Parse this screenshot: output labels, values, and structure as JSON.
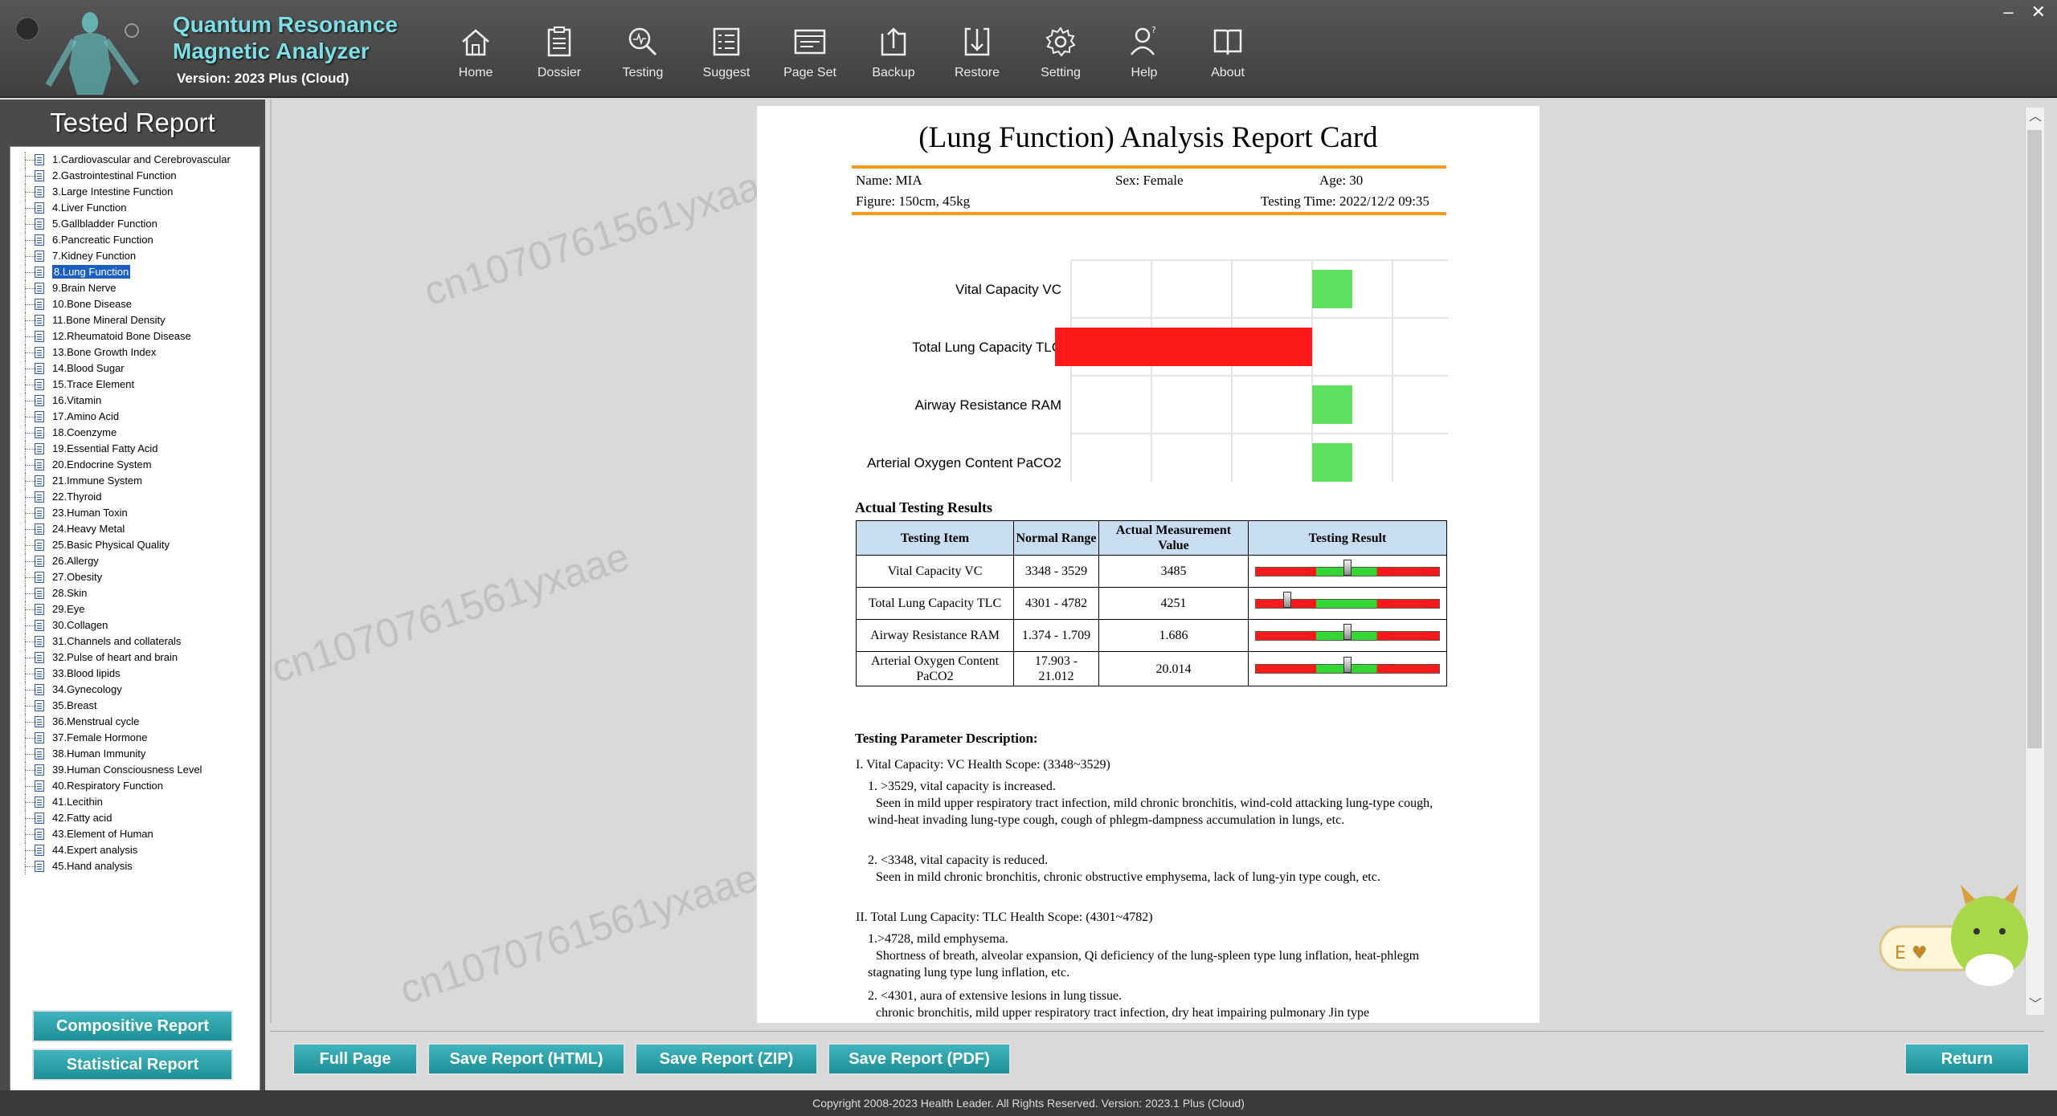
{
  "brand": {
    "title_line1": "Quantum Resonance",
    "title_line2": "Magnetic Analyzer",
    "version": "Version: 2023 Plus (Cloud)"
  },
  "toolbar": [
    {
      "label": "Home",
      "icon": "home-icon"
    },
    {
      "label": "Dossier",
      "icon": "clipboard-icon"
    },
    {
      "label": "Testing",
      "icon": "search-icon"
    },
    {
      "label": "Suggest",
      "icon": "list-icon"
    },
    {
      "label": "Page Set",
      "icon": "page-set-icon"
    },
    {
      "label": "Backup",
      "icon": "backup-icon"
    },
    {
      "label": "Restore",
      "icon": "restore-icon"
    },
    {
      "label": "Setting",
      "icon": "gear-icon"
    },
    {
      "label": "Help",
      "icon": "help-user-icon"
    },
    {
      "label": "About",
      "icon": "book-icon"
    }
  ],
  "window": {
    "minimize": "–",
    "close": "✕"
  },
  "left_panel": {
    "title": "Tested Report",
    "selected_index": 7,
    "items": [
      "1.Cardiovascular and Cerebrovascular",
      "2.Gastrointestinal Function",
      "3.Large Intestine Function",
      "4.Liver Function",
      "5.Gallbladder Function",
      "6.Pancreatic Function",
      "7.Kidney Function",
      "8.Lung Function",
      "9.Brain Nerve",
      "10.Bone Disease",
      "11.Bone Mineral Density",
      "12.Rheumatoid Bone Disease",
      "13.Bone Growth Index",
      "14.Blood Sugar",
      "15.Trace Element",
      "16.Vitamin",
      "17.Amino Acid",
      "18.Coenzyme",
      "19.Essential Fatty Acid",
      "20.Endocrine System",
      "21.Immune System",
      "22.Thyroid",
      "23.Human Toxin",
      "24.Heavy Metal",
      "25.Basic Physical Quality",
      "26.Allergy",
      "27.Obesity",
      "28.Skin",
      "29.Eye",
      "30.Collagen",
      "31.Channels and collaterals",
      "32.Pulse of heart and brain",
      "33.Blood lipids",
      "34.Gynecology",
      "35.Breast",
      "36.Menstrual cycle",
      "37.Female Hormone",
      "38.Human Immunity",
      "39.Human Consciousness Level",
      "40.Respiratory Function",
      "41.Lecithin",
      "42.Fatty acid",
      "43.Element of Human",
      "44.Expert analysis",
      "45.Hand analysis"
    ],
    "buttons": [
      "Compositive Report",
      "Statistical Report"
    ]
  },
  "watermark": "cn1070761561yxaae",
  "report": {
    "title": "(Lung Function) Analysis Report Card",
    "name": "Name: MIA",
    "sex": "Sex: Female",
    "age": "Age: 30",
    "figure": "Figure: 150cm, 45kg",
    "testing_time": "Testing Time: 2022/12/2 09:35",
    "results_heading": "Actual Testing Results",
    "table_headers": [
      "Testing Item",
      "Normal Range",
      "Actual Measurement Value",
      "Testing Result"
    ],
    "rows": [
      {
        "item": "Vital Capacity VC",
        "range": "3348 - 3529",
        "value": "3485",
        "position": 0.5
      },
      {
        "item": "Total Lung Capacity TLC",
        "range": "4301 - 4782",
        "value": "4251",
        "position": 0.17
      },
      {
        "item": "Airway Resistance RAM",
        "range": "1.374 - 1.709",
        "value": "1.686",
        "position": 0.5
      },
      {
        "item": "Arterial Oxygen Content PaCO2",
        "range": "17.903 - 21.012",
        "value": "20.014",
        "position": 0.5
      }
    ],
    "param_heading": "Testing Parameter Description:",
    "desc": {
      "s1_title": "I. Vital Capacity: VC Health Scope: (3348~3529)",
      "s1_p1_title": "1. >3529, vital capacity is increased.",
      "s1_p1_body": "Seen in mild upper respiratory tract infection, mild chronic bronchitis, wind-cold attacking lung-type cough, wind-heat invading lung-type cough, cough of phlegm-dampness accumulation in lungs, etc.",
      "s1_p2_title": "2. <3348, vital capacity is reduced.",
      "s1_p2_body": "Seen in mild chronic bronchitis, chronic obstructive emphysema, lack of lung-yin type cough, etc.",
      "s2_title": "II. Total Lung Capacity: TLC Health Scope: (4301~4782)",
      "s2_p1_title": "1.>4728, mild emphysema.",
      "s2_p1_body": "Shortness of breath, alveolar expansion, Qi deficiency of the lung-spleen type lung inflation, heat-phlegm stagnating lung type lung inflation, etc.",
      "s2_p2_title": "2. <4301, aura of extensive lesions in lung tissue.",
      "s2_p2_body": "chronic bronchitis, mild upper respiratory tract infection, dry heat impairing pulmonary Jin type"
    }
  },
  "chart_data": {
    "type": "bar",
    "orientation": "horizontal",
    "categories": [
      "Vital Capacity VC",
      "Total Lung Capacity TLC",
      "Airway Resistance RAM",
      "Arterial Oxygen Content PaCO2"
    ],
    "values": [
      0.5,
      -3.2,
      0.5,
      0.5
    ],
    "bar_colors": [
      "#5ee05e",
      "#ff1a1a",
      "#5ee05e",
      "#5ee05e"
    ],
    "tick_labels": [
      "[---]",
      "[--]",
      "[-]",
      "[-]",
      "[+]",
      "[++]",
      "[+++]"
    ],
    "xlim": [
      -3,
      3
    ],
    "grid": true,
    "title": "",
    "xlabel": "",
    "ylabel": ""
  },
  "bottom_buttons": [
    "Full Page",
    "Save Report (HTML)",
    "Save Report (ZIP)",
    "Save Report (PDF)"
  ],
  "return_button": "Return",
  "footer": "Copyright 2008-2023 Health Leader. All Rights Reserved.  Version: 2023.1 Plus (Cloud)"
}
